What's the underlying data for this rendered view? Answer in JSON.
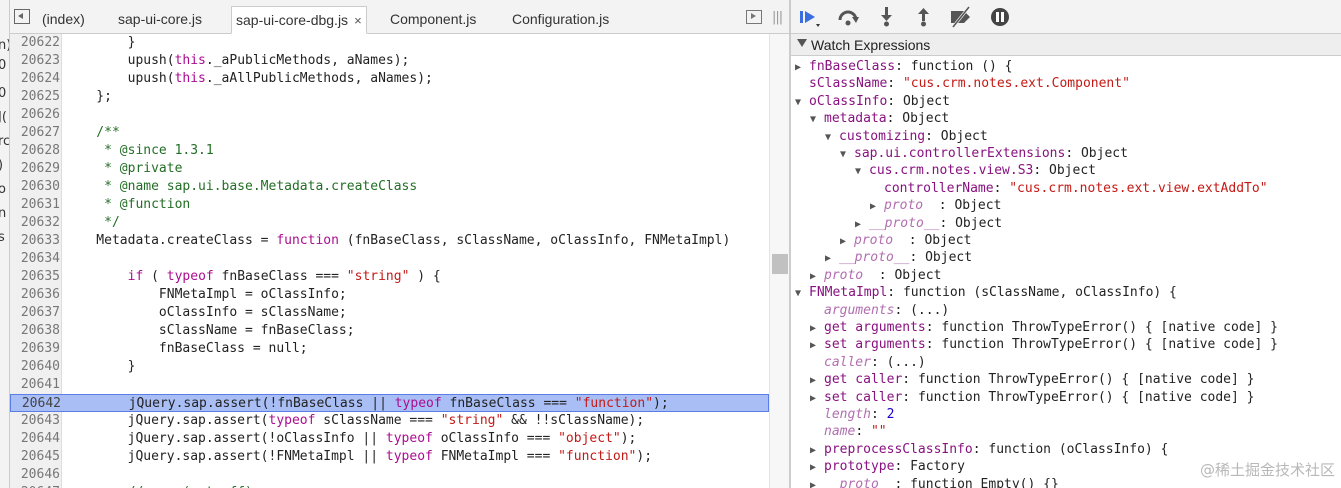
{
  "left_strip_fragments": [
    "n)",
    "0",
    "0",
    "J(",
    "rc",
    ")",
    "o",
    "n",
    "s"
  ],
  "tabs": [
    {
      "label": "(index)"
    },
    {
      "label": "sap-ui-core.js"
    },
    {
      "label": "sap-ui-core-dbg.js",
      "active": true,
      "close": "×"
    },
    {
      "label": "Component.js"
    },
    {
      "label": "Configuration.js"
    }
  ],
  "tab_bar_right_icon": "|||",
  "code": {
    "lines": [
      {
        "n": "20622",
        "parts": [
          {
            "t": "        }"
          }
        ]
      },
      {
        "n": "20623",
        "parts": [
          {
            "t": "        upush("
          },
          {
            "t": "this",
            "c": "kw"
          },
          {
            "t": "._aPublicMethods, aNames);"
          }
        ]
      },
      {
        "n": "20624",
        "parts": [
          {
            "t": "        upush("
          },
          {
            "t": "this",
            "c": "kw"
          },
          {
            "t": "._aAllPublicMethods, aNames);"
          }
        ]
      },
      {
        "n": "20625",
        "parts": [
          {
            "t": "    };"
          }
        ]
      },
      {
        "n": "20626",
        "parts": [
          {
            "t": ""
          }
        ]
      },
      {
        "n": "20627",
        "parts": [
          {
            "t": "    /**",
            "c": "cm"
          }
        ]
      },
      {
        "n": "20628",
        "parts": [
          {
            "t": "     * @since 1.3.1",
            "c": "cm"
          }
        ]
      },
      {
        "n": "20629",
        "parts": [
          {
            "t": "     * @private",
            "c": "cm"
          }
        ]
      },
      {
        "n": "20630",
        "parts": [
          {
            "t": "     * @name sap.ui.base.Metadata.createClass",
            "c": "cm"
          }
        ]
      },
      {
        "n": "20631",
        "parts": [
          {
            "t": "     * @function",
            "c": "cm"
          }
        ]
      },
      {
        "n": "20632",
        "parts": [
          {
            "t": "     */",
            "c": "cm"
          }
        ]
      },
      {
        "n": "20633",
        "parts": [
          {
            "t": "    Metadata.createClass = "
          },
          {
            "t": "function",
            "c": "kw"
          },
          {
            "t": " (fnBaseClass, sClassName, oClassInfo, FNMetaImpl)"
          }
        ]
      },
      {
        "n": "20634",
        "parts": [
          {
            "t": ""
          }
        ]
      },
      {
        "n": "20635",
        "parts": [
          {
            "t": "        "
          },
          {
            "t": "if",
            "c": "kw"
          },
          {
            "t": " ( "
          },
          {
            "t": "typeof",
            "c": "kw"
          },
          {
            "t": " fnBaseClass === "
          },
          {
            "t": "\"string\"",
            "c": "str"
          },
          {
            "t": " ) {"
          }
        ]
      },
      {
        "n": "20636",
        "parts": [
          {
            "t": "            FNMetaImpl = oClassInfo;"
          }
        ]
      },
      {
        "n": "20637",
        "parts": [
          {
            "t": "            oClassInfo = sClassName;"
          }
        ]
      },
      {
        "n": "20638",
        "parts": [
          {
            "t": "            sClassName = fnBaseClass;"
          }
        ]
      },
      {
        "n": "20639",
        "parts": [
          {
            "t": "            fnBaseClass = null;"
          }
        ]
      },
      {
        "n": "20640",
        "parts": [
          {
            "t": "        }"
          }
        ]
      },
      {
        "n": "20641",
        "parts": [
          {
            "t": ""
          }
        ]
      },
      {
        "n": "20642",
        "current": true,
        "parts": [
          {
            "t": "        jQuery.sap.assert(!fnBaseClass || "
          },
          {
            "t": "typeof",
            "c": "kw"
          },
          {
            "t": " fnBaseClass === "
          },
          {
            "t": "\"function\"",
            "c": "str"
          },
          {
            "t": ");"
          }
        ]
      },
      {
        "n": "20643",
        "parts": [
          {
            "t": "        jQuery.sap.assert("
          },
          {
            "t": "typeof",
            "c": "kw"
          },
          {
            "t": " sClassName === "
          },
          {
            "t": "\"string\"",
            "c": "str"
          },
          {
            "t": " && !!sClassName);"
          }
        ]
      },
      {
        "n": "20644",
        "parts": [
          {
            "t": "        jQuery.sap.assert(!oClassInfo || "
          },
          {
            "t": "typeof",
            "c": "kw"
          },
          {
            "t": " oClassInfo === "
          },
          {
            "t": "\"object\"",
            "c": "str"
          },
          {
            "t": ");"
          }
        ]
      },
      {
        "n": "20645",
        "parts": [
          {
            "t": "        jQuery.sap.assert(!FNMetaImpl || "
          },
          {
            "t": "typeof",
            "c": "kw"
          },
          {
            "t": " FNMetaImpl === "
          },
          {
            "t": "\"function\"",
            "c": "str"
          },
          {
            "t": ");"
          }
        ]
      },
      {
        "n": "20646",
        "parts": [
          {
            "t": ""
          }
        ]
      },
      {
        "n": "20647",
        "parts": [
          {
            "t": "        // ... (cut off)",
            "c": "cm"
          }
        ]
      }
    ]
  },
  "watch": {
    "title": "Watch Expressions",
    "rows": [
      {
        "indent": 0,
        "arrow": "right",
        "key": "fnBaseClass",
        "sep": ": ",
        "value": "function () {",
        "vt": "fn"
      },
      {
        "indent": 0,
        "arrow": "none",
        "key": "sClassName",
        "sep": ": ",
        "value": "\"cus.crm.notes.ext.Component\"",
        "vt": "str"
      },
      {
        "indent": 0,
        "arrow": "down",
        "key": "oClassInfo",
        "sep": ": ",
        "value": "Object",
        "vt": "obj"
      },
      {
        "indent": 1,
        "arrow": "down",
        "key": "metadata",
        "sep": ": ",
        "value": "Object",
        "vt": "obj"
      },
      {
        "indent": 2,
        "arrow": "down",
        "key": "customizing",
        "sep": ": ",
        "value": "Object",
        "vt": "obj"
      },
      {
        "indent": 3,
        "arrow": "down",
        "key": "sap.ui.controllerExtensions",
        "sep": ": ",
        "value": "Object",
        "vt": "obj"
      },
      {
        "indent": 4,
        "arrow": "down",
        "key": "cus.crm.notes.view.S3",
        "sep": ": ",
        "value": "Object",
        "vt": "obj"
      },
      {
        "indent": 5,
        "arrow": "none",
        "key": "controllerName",
        "sep": ": ",
        "value": "\"cus.crm.notes.ext.view.extAddTo\"",
        "vt": "str"
      },
      {
        "indent": 5,
        "arrow": "right",
        "key": "proto",
        "sep": "  : ",
        "value": "Object",
        "vt": "obj",
        "dim": true
      },
      {
        "indent": 4,
        "arrow": "right",
        "key": "__proto__",
        "sep": ": ",
        "value": "Object",
        "vt": "obj",
        "dim": true
      },
      {
        "indent": 3,
        "arrow": "right",
        "key": "proto",
        "sep": "  : ",
        "value": "Object",
        "vt": "obj",
        "dim": true
      },
      {
        "indent": 2,
        "arrow": "right",
        "key": "__proto__",
        "sep": ": ",
        "value": "Object",
        "vt": "obj",
        "dim": true
      },
      {
        "indent": 1,
        "arrow": "right",
        "key": "proto",
        "sep": "  : ",
        "value": "Object",
        "vt": "obj",
        "dim": true
      },
      {
        "indent": 0,
        "arrow": "down",
        "key": "FNMetaImpl",
        "sep": ": ",
        "value": "function (sClassName, oClassInfo) {",
        "vt": "fn"
      },
      {
        "indent": 1,
        "arrow": "none",
        "key": "arguments",
        "sep": ": ",
        "value": "(...)",
        "vt": "obj",
        "dim": true
      },
      {
        "indent": 1,
        "arrow": "right",
        "key": "get arguments",
        "sep": ": ",
        "value": "function ThrowTypeError() { [native code] }",
        "vt": "fn"
      },
      {
        "indent": 1,
        "arrow": "right",
        "key": "set arguments",
        "sep": ": ",
        "value": "function ThrowTypeError() { [native code] }",
        "vt": "fn"
      },
      {
        "indent": 1,
        "arrow": "none",
        "key": "caller",
        "sep": ": ",
        "value": "(...)",
        "vt": "obj",
        "dim": true
      },
      {
        "indent": 1,
        "arrow": "right",
        "key": "get caller",
        "sep": ": ",
        "value": "function ThrowTypeError() { [native code] }",
        "vt": "fn"
      },
      {
        "indent": 1,
        "arrow": "right",
        "key": "set caller",
        "sep": ": ",
        "value": "function ThrowTypeError() { [native code] }",
        "vt": "fn"
      },
      {
        "indent": 1,
        "arrow": "none",
        "key": "length",
        "sep": ": ",
        "value": "2",
        "vt": "num",
        "dim": true
      },
      {
        "indent": 1,
        "arrow": "none",
        "key": "name",
        "sep": ": ",
        "value": "\"\"",
        "vt": "str",
        "dim": true
      },
      {
        "indent": 1,
        "arrow": "right",
        "key": "preprocessClassInfo",
        "sep": ": ",
        "value": "function (oClassInfo) {",
        "vt": "fn"
      },
      {
        "indent": 1,
        "arrow": "right",
        "key": "prototype",
        "sep": ": ",
        "value": "Factory",
        "vt": "obj"
      },
      {
        "indent": 1,
        "arrow": "right",
        "key": "__proto__",
        "sep": ": ",
        "value": "function Empty() {}",
        "vt": "fn",
        "dim": true
      }
    ]
  },
  "watermark": "@稀土掘金技术社区"
}
